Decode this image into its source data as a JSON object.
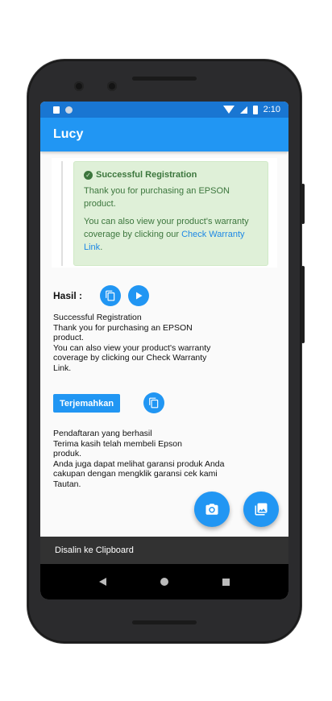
{
  "status_bar": {
    "time": "2:10"
  },
  "app": {
    "title": "Lucy"
  },
  "web_result": {
    "alert_title": "Successful Registration",
    "line1": "Thank you for purchasing an EPSON product.",
    "line2_prefix": "You can also view your product's warranty coverage by clicking our ",
    "link_text": "Check Warranty Link",
    "line2_suffix": "."
  },
  "hasil": {
    "label": "Hasil :",
    "text": "Successful Registration\nThank you for purchasing an EPSON\nproduct.\nYou can also view your product's warranty\ncoverage by clicking our Check Warranty\nLink."
  },
  "translate": {
    "button_label": "Terjemahkan",
    "text": "Pendaftaran yang berhasil\nTerima kasih telah membeli Epson\nproduk.\nAnda juga dapat melihat garansi produk Anda\ncakupan dengan mengklik garansi cek kami\nTautan."
  },
  "snackbar": {
    "message": "Disalin ke Clipboard"
  },
  "icons": {
    "copy": "copy-icon",
    "play": "play-icon",
    "camera": "camera-icon",
    "gallery": "gallery-icon"
  },
  "colors": {
    "primary": "#2196f3",
    "primary_dark": "#1976d2",
    "alert_bg": "#dff0d8",
    "alert_text": "#3c763d",
    "link": "#1e88e5",
    "snackbar_bg": "#323232"
  }
}
